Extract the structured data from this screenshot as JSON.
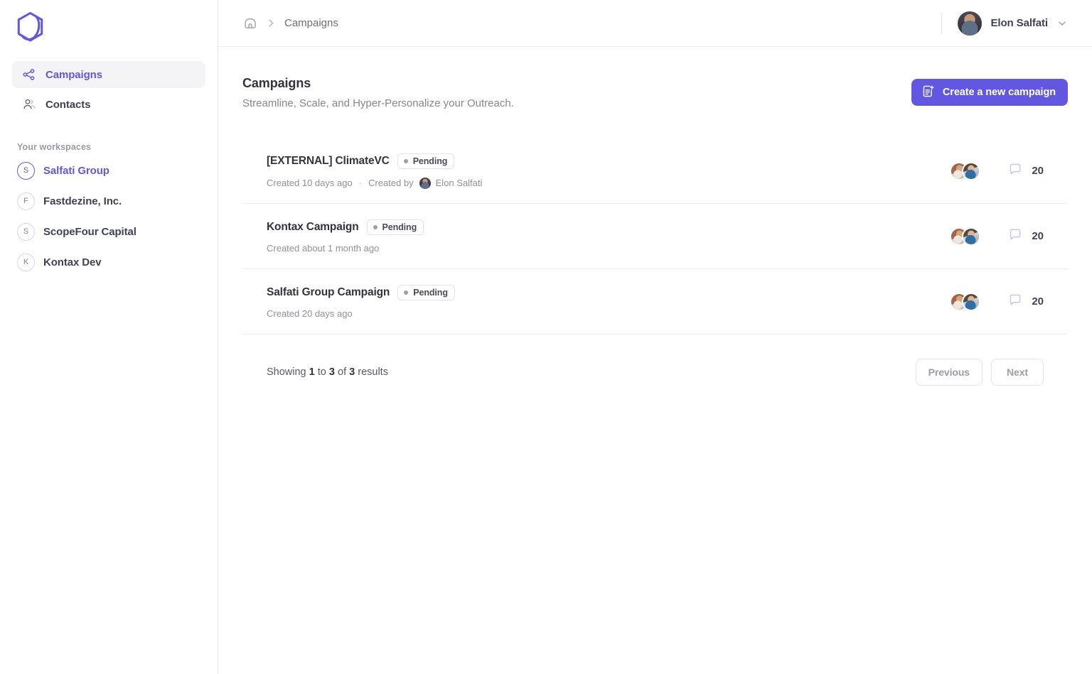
{
  "brand": {
    "logo_icon": "hexagon-logo",
    "accent": "#6257e0"
  },
  "sidebar": {
    "nav": [
      {
        "label": "Campaigns",
        "icon": "share-nodes-icon",
        "active": true
      },
      {
        "label": "Contacts",
        "icon": "users-icon",
        "active": false
      }
    ],
    "workspaces_heading": "Your workspaces",
    "workspaces": [
      {
        "initial": "S",
        "label": "Salfati Group",
        "active": true
      },
      {
        "initial": "F",
        "label": "Fastdezine, Inc.",
        "active": false
      },
      {
        "initial": "S",
        "label": "ScopeFour Capital",
        "active": false
      },
      {
        "initial": "K",
        "label": "Kontax Dev",
        "active": false
      }
    ]
  },
  "topbar": {
    "home_icon": "home-icon",
    "separator": "›",
    "breadcrumb": "Campaigns",
    "user_name": "Elon Salfati",
    "chevron_icon": "chevron-down-icon",
    "avatar_icon": "user-avatar"
  },
  "page": {
    "title": "Campaigns",
    "subtitle": "Streamline, Scale, and Hyper-Personalize your Outreach.",
    "create_button": {
      "label": "Create a new campaign",
      "icon": "document-plus-icon"
    }
  },
  "campaigns": [
    {
      "title": "[EXTERNAL] ClimateVC",
      "status": "Pending",
      "created": "Created 10 days ago",
      "meta_separator": "·",
      "created_by_label": "Created by",
      "created_by_name": "Elon Salfati",
      "message_count": "20",
      "message_icon": "chat-bubble-icon"
    },
    {
      "title": "Kontax Campaign",
      "status": "Pending",
      "created": "Created about 1 month ago",
      "meta_separator": "",
      "created_by_label": "",
      "created_by_name": "",
      "message_count": "20",
      "message_icon": "chat-bubble-icon"
    },
    {
      "title": "Salfati Group Campaign",
      "status": "Pending",
      "created": "Created 20 days ago",
      "meta_separator": "",
      "created_by_label": "",
      "created_by_name": "",
      "message_count": "20",
      "message_icon": "chat-bubble-icon"
    }
  ],
  "pagination": {
    "showing_prefix": "Showing",
    "from": "1",
    "to_word": "to",
    "to": "3",
    "of_word": "of",
    "total": "3",
    "results_word": "results",
    "previous": "Previous",
    "next": "Next"
  }
}
